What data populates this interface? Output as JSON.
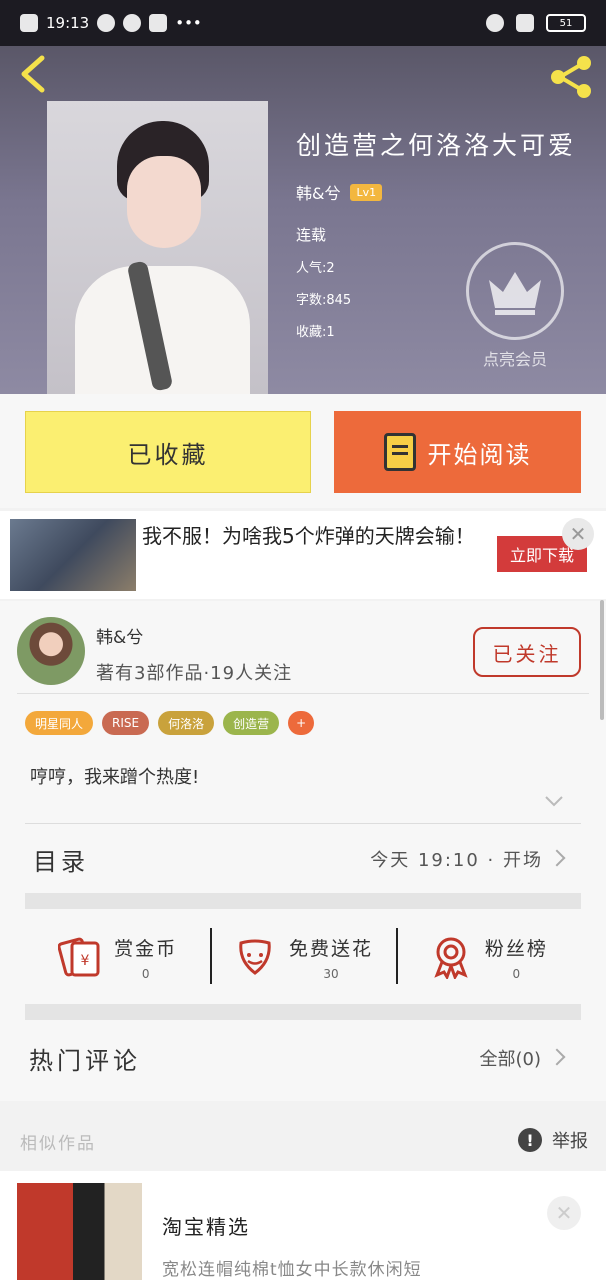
{
  "status_bar": {
    "time": "19:13",
    "more": "•••",
    "battery": "51"
  },
  "header": {
    "back_icon": "back-chevron-icon",
    "share_icon": "share-icon"
  },
  "book": {
    "title": "创造营之何洛洛大可爱",
    "author": "韩&兮",
    "level": "Lv1",
    "state": "连载",
    "popularity": "人气:2",
    "word_count": "字数:845",
    "favorites": "收藏:1",
    "vip_label": "点亮会员"
  },
  "actions": {
    "favorited_label": "已收藏",
    "read_label": "开始阅读"
  },
  "ad": {
    "text": "我不服！为啥我5个炸弹的天牌会输！",
    "button": "立即下载",
    "close": "✕"
  },
  "author_card": {
    "name": "韩&兮",
    "subtitle": "著有3部作品·19人关注",
    "follow_label": "已关注",
    "tags": [
      "明星同人",
      "RISE",
      "何洛洛",
      "创造营",
      "+"
    ],
    "intro": "哼哼，我来蹭个热度!"
  },
  "toc": {
    "title": "目录",
    "update": "今天 19:10 · 开场"
  },
  "stats": [
    {
      "label": "赏金币",
      "value": "0",
      "icon": "red-envelope-icon"
    },
    {
      "label": "免费送花",
      "value": "30",
      "icon": "flower-icon"
    },
    {
      "label": "粉丝榜",
      "value": "0",
      "icon": "medal-icon"
    }
  ],
  "comments": {
    "title": "热门评论",
    "all": "全部(0)"
  },
  "similar": {
    "title": "相似作品",
    "report": "举报"
  },
  "ad2": {
    "title": "淘宝精选",
    "subtitle": "宽松连帽纯棉t恤女中长款休闲短",
    "close": "✕"
  },
  "colors": {
    "accent_orange": "#ed6a3b",
    "fav_yellow": "#fbef71",
    "follow_red": "#c0392b",
    "tag_colors": [
      "#f3a83b",
      "#c96a52",
      "#c9a23c",
      "#9bb54c",
      "#ed6a3b"
    ]
  }
}
